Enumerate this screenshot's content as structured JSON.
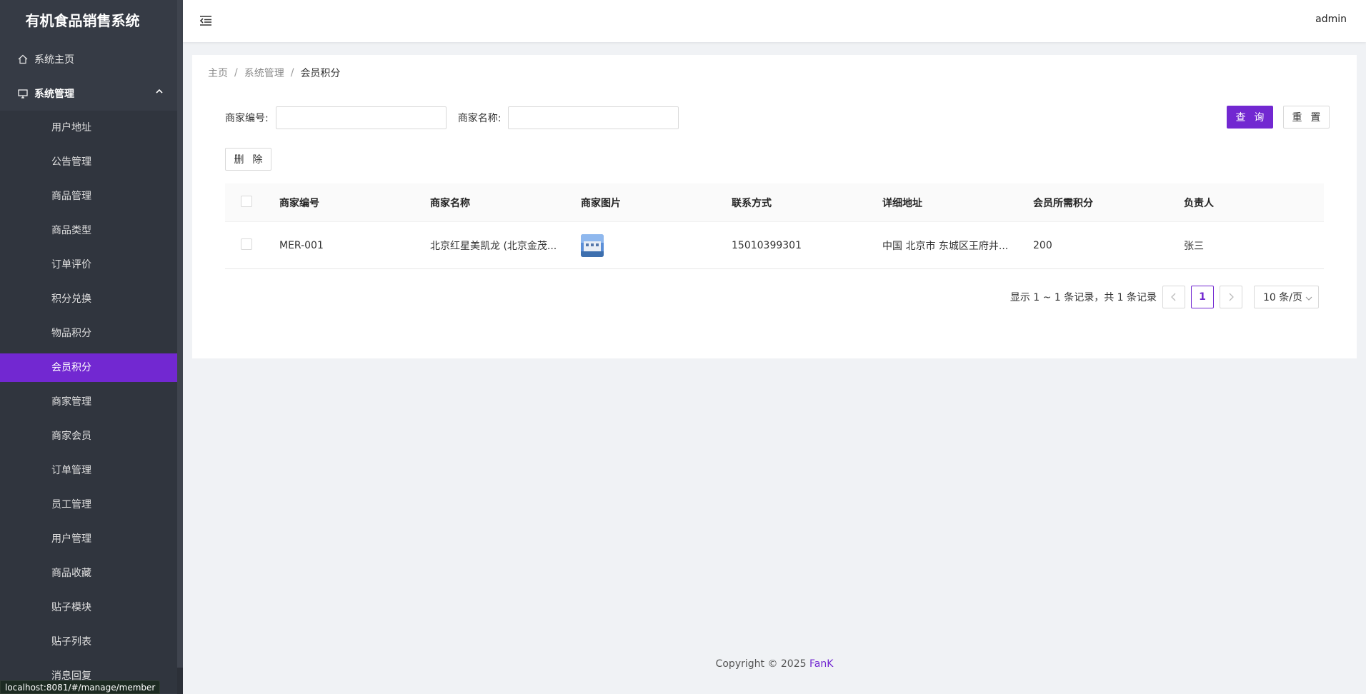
{
  "app": {
    "title": "有机食品销售系统"
  },
  "sidebar": {
    "home_label": "系统主页",
    "group_label": "系统管理",
    "items": [
      {
        "label": "用户地址"
      },
      {
        "label": "公告管理"
      },
      {
        "label": "商品管理"
      },
      {
        "label": "商品类型"
      },
      {
        "label": "订单评价"
      },
      {
        "label": "积分兑换"
      },
      {
        "label": "物品积分"
      },
      {
        "label": "会员积分",
        "active": true
      },
      {
        "label": "商家管理"
      },
      {
        "label": "商家会员"
      },
      {
        "label": "订单管理"
      },
      {
        "label": "员工管理"
      },
      {
        "label": "用户管理"
      },
      {
        "label": "商品收藏"
      },
      {
        "label": "贴子模块"
      },
      {
        "label": "贴子列表"
      },
      {
        "label": "消息回复"
      }
    ]
  },
  "header": {
    "user": "admin",
    "menu_icon": "menu-fold-icon"
  },
  "breadcrumb": [
    "主页",
    "系统管理",
    "会员积分"
  ],
  "search": {
    "merchant_no_label": "商家编号:",
    "merchant_no_value": "",
    "merchant_name_label": "商家名称:",
    "merchant_name_value": "",
    "query_label": "查 询",
    "reset_label": "重 置"
  },
  "actions": {
    "delete_label": "删 除"
  },
  "table": {
    "columns": [
      "商家编号",
      "商家名称",
      "商家图片",
      "联系方式",
      "详细地址",
      "会员所需积分",
      "负责人"
    ],
    "rows": [
      {
        "merchant_no": "MER-001",
        "merchant_name": "北京红星美凯龙 (北京金茂...",
        "phone": "15010399301",
        "address": "中国 北京市 东城区王府井...",
        "points": "200",
        "manager": "张三"
      }
    ]
  },
  "pagination": {
    "total_text": "显示 1 ~ 1 条记录，共 1 条记录",
    "current_page": "1",
    "page_size": "10 条/页"
  },
  "footer": {
    "copyright": "Copyright © 2025",
    "author": "FanK"
  },
  "status_bar": {
    "url": "localhost:8081/#/manage/member"
  },
  "colors": {
    "accent": "#7228d1",
    "sidebar_bg": "#363b45"
  }
}
